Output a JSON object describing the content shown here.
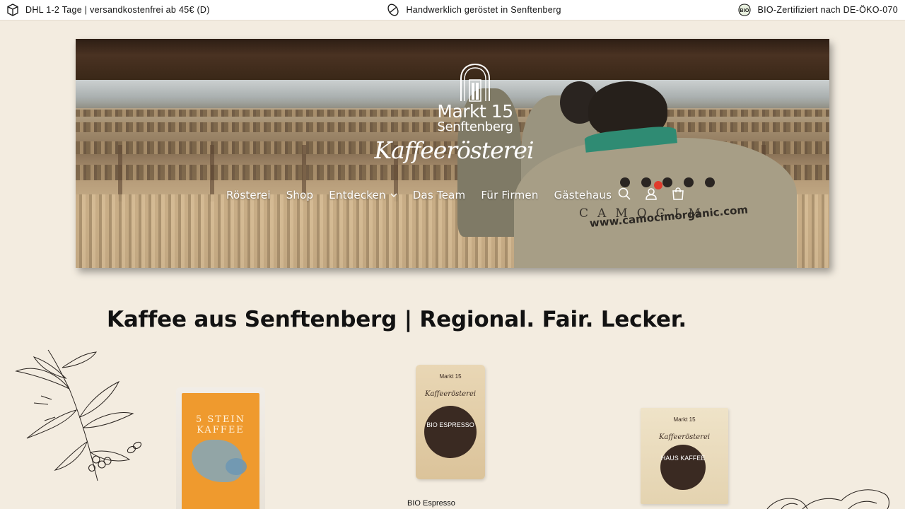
{
  "announcement": {
    "shipping": "DHL 1-2 Tage | versandkostenfrei ab 45€ (D)",
    "roasting": "Handwerklich geröstet in Senftenberg",
    "organic": "BIO-Zertifiziert nach DE-ÖKO-070",
    "icons": [
      "box-icon",
      "coffee-bean-icon",
      "bio-seal-icon"
    ]
  },
  "header": {
    "logo": {
      "brand": "Markt 15",
      "city": "Senftenberg",
      "script": "Kaffeerösterei"
    },
    "nav": [
      {
        "label": "Rösterei"
      },
      {
        "label": "Shop"
      },
      {
        "label": "Entdecken"
      },
      {
        "label": "Das Team"
      },
      {
        "label": "Für Firmen"
      },
      {
        "label": "Gästehaus"
      }
    ],
    "icons": [
      "search-icon",
      "account-icon",
      "cart-icon"
    ]
  },
  "hero": {
    "sign_brand": "CAMOCIM",
    "sign_url": "www.camocimorganic.com"
  },
  "main": {
    "title": "Kaffee aus Senftenberg | Regional. Fair. Lecker."
  },
  "products": [
    {
      "bag_text": "5 STEIN KAFFEE"
    },
    {
      "bag_brand": "Markt 15",
      "bag_script": "Kaffeerösterei",
      "bag_name": "BIO ESPRESSO",
      "caption": "BIO Espresso"
    },
    {
      "bag_brand": "Markt 15",
      "bag_script": "Kaffeerösterei",
      "bag_name": "HAUS KAFFEE"
    }
  ],
  "colors": {
    "background": "#f3ece0",
    "topbar": "#ffffff",
    "text": "#121212",
    "cart_badge": "#e03b2c"
  }
}
